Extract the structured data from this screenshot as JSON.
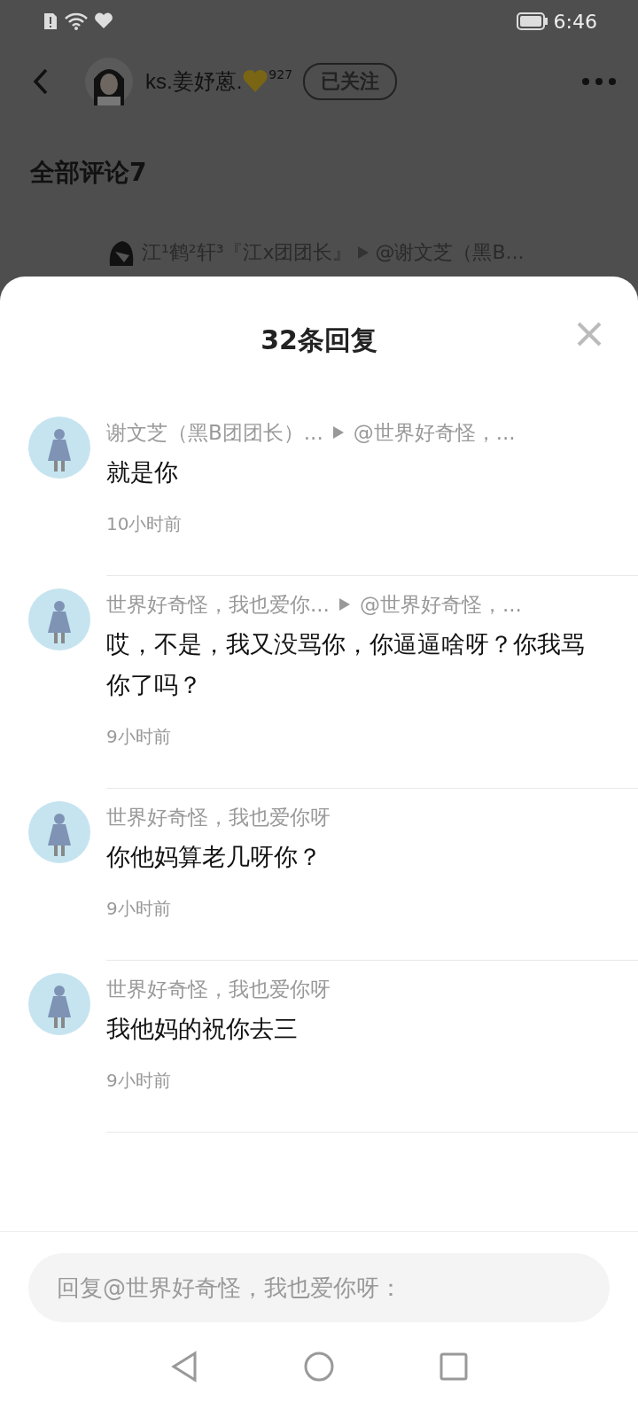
{
  "status_bar": {
    "time": "6:46"
  },
  "header": {
    "username": "ks.姜妤蒽.",
    "badge_count": "927",
    "follow_button": "已关注"
  },
  "section_title": "全部评论7",
  "background_comment": {
    "name": "江¹鹤²轩³『江x团团长』",
    "reply_to": "@谢文芝（黑B..."
  },
  "sheet": {
    "title": "32条回复",
    "comments": [
      {
        "name": "谢文芝（黑B团团长）...",
        "reply_to": "@世界好奇怪，...",
        "text": "就是你",
        "time": "10小时前"
      },
      {
        "name": "世界好奇怪，我也爱你...",
        "reply_to": "@世界好奇怪，...",
        "text": "哎，不是，我又没骂你，你逼逼啥呀？你我骂你了吗？",
        "time": "9小时前"
      },
      {
        "name": "世界好奇怪，我也爱你呀",
        "text": "你他妈算老几呀你？",
        "time": "9小时前"
      },
      {
        "name": "世界好奇怪，我也爱你呀",
        "text": "我他妈的祝你去三",
        "time": "9小时前"
      }
    ],
    "reply_field": {
      "placeholder": "回复@世界好奇怪，我也爱你呀："
    }
  }
}
